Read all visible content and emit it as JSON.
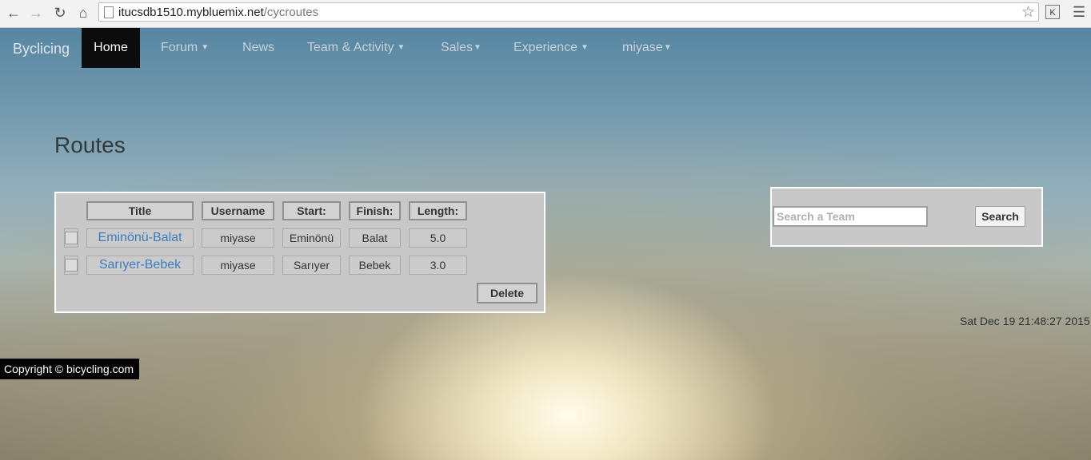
{
  "browser": {
    "url_host": "itucsdb1510.mybluemix.net",
    "url_path": "/cycroutes",
    "extension_label": "K"
  },
  "navbar": {
    "brand": "Byclicing",
    "home": "Home",
    "items": [
      {
        "label": "Forum",
        "caret": true
      },
      {
        "label": "News",
        "caret": false
      },
      {
        "label": "Team & Activity",
        "caret": true
      },
      {
        "label": "Sales",
        "caret": true
      },
      {
        "label": "Experience",
        "caret": true
      },
      {
        "label": "miyase",
        "caret": true
      }
    ]
  },
  "page": {
    "heading": "Routes"
  },
  "routes_table": {
    "headers": [
      "Title",
      "Username",
      "Start:",
      "Finish:",
      "Length:"
    ],
    "rows": [
      {
        "title": "Eminönü-Balat",
        "username": "miyase",
        "start": "Eminönü",
        "finish": "Balat",
        "length": "5.0"
      },
      {
        "title": "Sarıyer-Bebek",
        "username": "miyase",
        "start": "Sarıyer",
        "finish": "Bebek",
        "length": "3.0"
      }
    ],
    "delete_label": "Delete"
  },
  "search": {
    "placeholder": "Search a Team",
    "value": "",
    "button_label": "Search"
  },
  "datetime": "Sat Dec 19 21:48:27 2015",
  "footer": "Copyright © bicycling.com"
}
